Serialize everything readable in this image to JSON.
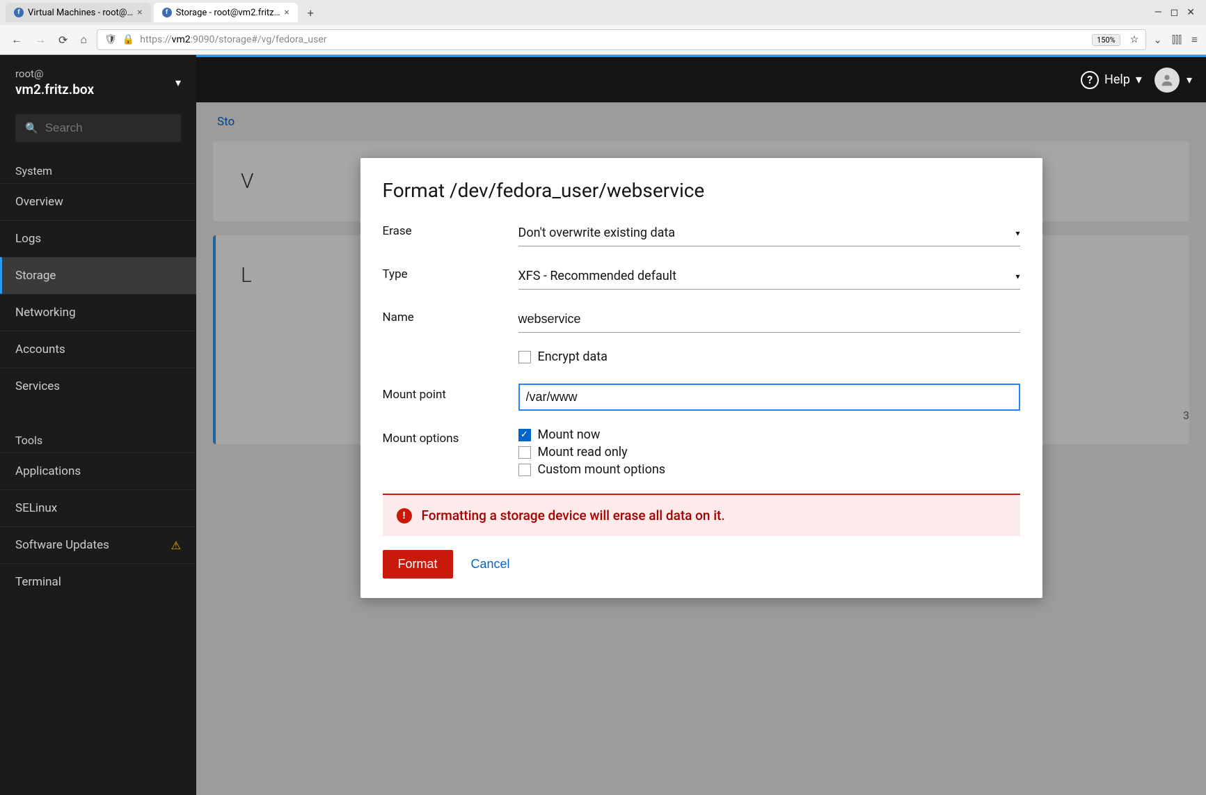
{
  "browser": {
    "tabs": [
      {
        "title": "Virtual Machines - root@…"
      },
      {
        "title": "Storage - root@vm2.fritz…"
      }
    ],
    "url_prefix": "https://",
    "url_host": "vm2",
    "url_path": ":9090/storage#/vg/fedora_user",
    "zoom": "150%"
  },
  "sidebar": {
    "user": "root@",
    "host": "vm2.fritz.box",
    "search_placeholder": "Search",
    "group_system": "System",
    "items_top": [
      "Overview",
      "Logs",
      "Storage",
      "Networking",
      "Accounts",
      "Services"
    ],
    "group_tools": "Tools",
    "items_tools": [
      "Applications",
      "SELinux",
      "Software Updates",
      "Terminal"
    ]
  },
  "header": {
    "help": "Help"
  },
  "content": {
    "breadcrumb": "Sto",
    "bg_v": "V",
    "bg_l": "L",
    "bg_right": "3"
  },
  "modal": {
    "title": "Format /dev/fedora_user/webservice",
    "labels": {
      "erase": "Erase",
      "type": "Type",
      "name": "Name",
      "mount_point": "Mount point",
      "mount_options": "Mount options"
    },
    "erase_value": "Don't overwrite existing data",
    "type_value": "XFS - Recommended default",
    "name_value": "webservice",
    "encrypt_label": "Encrypt data",
    "mount_point_value": "/var/www",
    "mount_now": "Mount now",
    "mount_ro": "Mount read only",
    "mount_custom": "Custom mount options",
    "alert": "Formatting a storage device will erase all data on it.",
    "format_btn": "Format",
    "cancel_btn": "Cancel"
  }
}
